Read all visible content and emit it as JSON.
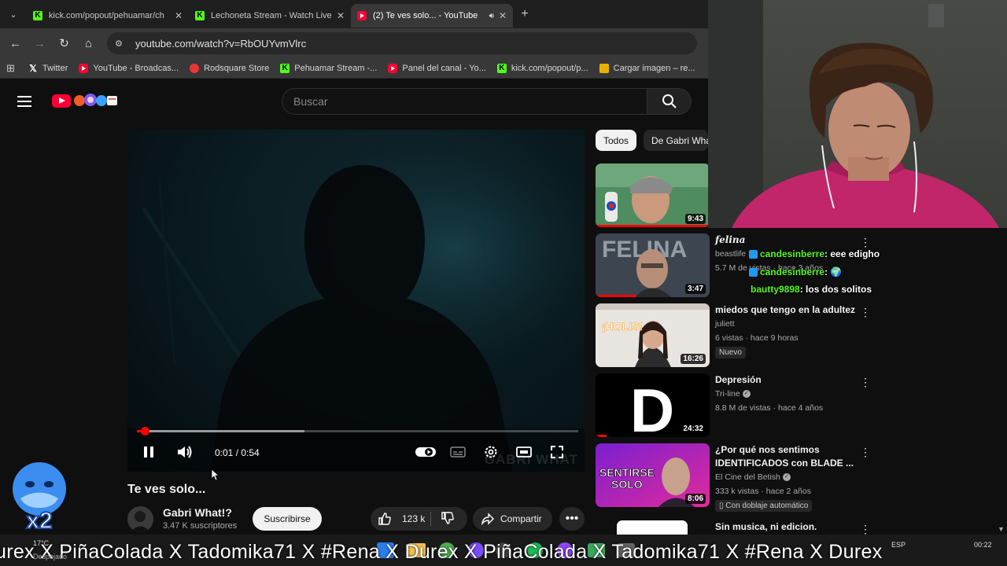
{
  "browser": {
    "tabs": [
      {
        "title": "kick.com/popout/pehuamar/ch",
        "favicon": "kick"
      },
      {
        "title": "Lechoneta Stream - Watch Live",
        "favicon": "kick"
      },
      {
        "title": "(2) Te ves solo... - YouTube",
        "favicon": "youtube",
        "active": true
      }
    ],
    "url": "youtube.com/watch?v=RbOUYvmVlrc",
    "bookmarks": [
      {
        "label": "Twitter",
        "icon": "x"
      },
      {
        "label": "YouTube - Broadcas...",
        "icon": "youtube"
      },
      {
        "label": "Rodsquare Store",
        "icon": "store"
      },
      {
        "label": "Pehuamar Stream -...",
        "icon": "kick"
      },
      {
        "label": "Panel del canal - Yo...",
        "icon": "youtube"
      },
      {
        "label": "kick.com/popout/p...",
        "icon": "kick"
      },
      {
        "label": "Cargar imagen – re...",
        "icon": "image"
      }
    ]
  },
  "youtube": {
    "search_placeholder": "Buscar",
    "video": {
      "title": "Te ves solo...",
      "current_time": "0:01",
      "duration": "0:54",
      "time_display": "0:01 / 0:54",
      "progress_fraction": 0.018,
      "buffered_fraction": 0.38,
      "watermark": "GABRI WHAT"
    },
    "channel": {
      "name": "Gabri What!?",
      "subscribers": "3.47 K suscriptores",
      "subscribe_label": "Suscribirse"
    },
    "actions": {
      "likes": "123 k",
      "share_label": "Compartir"
    },
    "chips": [
      "Todos",
      "De Gabri What"
    ],
    "recommendations": [
      {
        "title": "",
        "channel": "",
        "meta": "",
        "duration": "9:43"
      },
      {
        "title": "felina",
        "channel": "beastlife",
        "meta": "5.7 M de vistas · hace 3 años",
        "duration": "3:47"
      },
      {
        "title": "miedos que tengo en la adultez",
        "channel": "juliett",
        "meta": "6 vistas · hace 9 horas",
        "badge": "Nuevo",
        "duration": "16:26",
        "thumb_text": "¡HOLIS!"
      },
      {
        "title": "Depresión",
        "channel": "Tri-line",
        "meta": "8.8 M de vistas · hace 4 años",
        "duration": "24:32",
        "thumb_text": "D"
      },
      {
        "title": "¿Por qué nos sentimos IDENTIFICADOS con BLADE ...",
        "channel": "El Cine del Betish",
        "meta": "333 k vistas · hace 2 años",
        "badge": "Con doblaje automático",
        "duration": "8:06",
        "thumb_text_1": "SENTIRSE",
        "thumb_text_2": "SOLO"
      },
      {
        "title": "Sin musica, ni edicion.",
        "channel": "",
        "meta": "",
        "duration": ""
      }
    ]
  },
  "chat": [
    {
      "user": "candesinberre",
      "message": ": eee edigho"
    },
    {
      "user": "candesinberre",
      "message": ": 🌍"
    },
    {
      "user": "bautty9898",
      "message": ": los dos solitos"
    }
  ],
  "overlay": {
    "ticker": "urex  X  PiñaColada  X  Tadomika71  X  #Rena  X  Durex  X  PiñaColada  X  Tadomika71  X  #Rena  X  Durex",
    "multiplier": "x2"
  },
  "taskbar": {
    "weather": "17°C",
    "weather_sub": "Despejado",
    "lang": "ESP",
    "time": "00:22"
  },
  "colors": {
    "yt_red": "#ff0000",
    "kick_green": "#53fc18",
    "chat_user": "#53fc18"
  }
}
